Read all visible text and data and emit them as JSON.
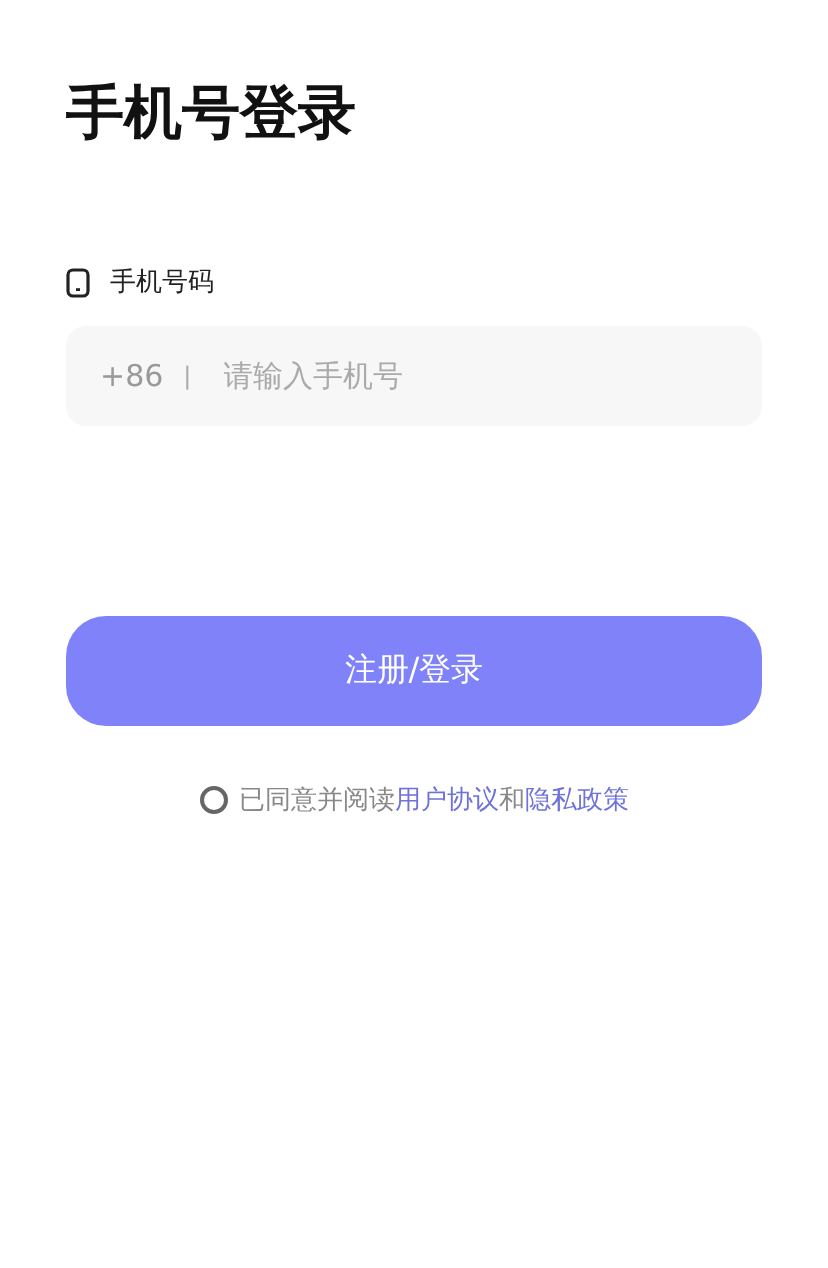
{
  "title": "手机号登录",
  "phone_field": {
    "label": "手机号码",
    "country_code": "+86",
    "separator": "|",
    "placeholder": "请输入手机号"
  },
  "submit_button": {
    "label": "注册/登录"
  },
  "agreement": {
    "checked": false,
    "parts": [
      {
        "kind": "text",
        "text": "已同意并阅读"
      },
      {
        "kind": "link",
        "text": "用户协议"
      },
      {
        "kind": "text",
        "text": "和"
      },
      {
        "kind": "link",
        "text": "隐私政策"
      }
    ]
  }
}
